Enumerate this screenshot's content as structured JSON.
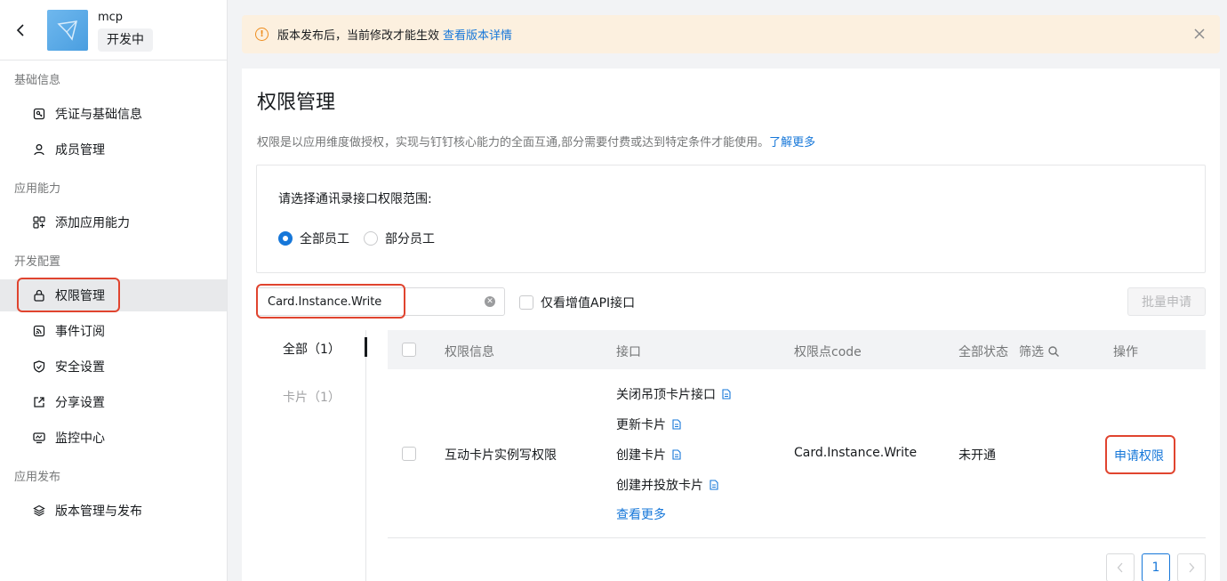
{
  "app": {
    "name": "mcp",
    "status": "开发中"
  },
  "sidebar": {
    "groups": [
      {
        "title": "基础信息",
        "items": [
          {
            "label": "凭证与基础信息",
            "icon": "credential-icon"
          },
          {
            "label": "成员管理",
            "icon": "user-icon"
          }
        ]
      },
      {
        "title": "应用能力",
        "items": [
          {
            "label": "添加应用能力",
            "icon": "apps-add-icon"
          }
        ]
      },
      {
        "title": "开发配置",
        "items": [
          {
            "label": "权限管理",
            "icon": "lock-icon",
            "active": true
          },
          {
            "label": "事件订阅",
            "icon": "rss-icon"
          },
          {
            "label": "安全设置",
            "icon": "shield-icon"
          },
          {
            "label": "分享设置",
            "icon": "share-icon"
          },
          {
            "label": "监控中心",
            "icon": "monitor-icon"
          }
        ]
      },
      {
        "title": "应用发布",
        "items": [
          {
            "label": "版本管理与发布",
            "icon": "layers-icon"
          }
        ]
      }
    ]
  },
  "notice": {
    "text": "版本发布后，当前修改才能生效",
    "link": "查看版本详情"
  },
  "main": {
    "title": "权限管理",
    "desc": "权限是以应用维度做授权，实现与钉钉核心能力的全面互通,部分需要付费或达到特定条件才能使用。",
    "desc_link": "了解更多",
    "scope_label": "请选择通讯录接口权限范围:",
    "radio_all": "全部员工",
    "radio_part": "部分员工",
    "search_value": "Card.Instance.Write",
    "only_value_api": "仅看增值API接口",
    "batch_apply": "批量申请",
    "tabs": [
      {
        "label": "全部（1）"
      },
      {
        "label": "卡片（1）"
      }
    ],
    "columns": {
      "info": "权限信息",
      "api": "接口",
      "code": "权限点code",
      "status": "全部状态",
      "filter": "筛选",
      "action": "操作"
    },
    "row": {
      "name": "互动卡片实例写权限",
      "apis": [
        "关闭吊顶卡片接口",
        "更新卡片",
        "创建卡片",
        "创建并投放卡片"
      ],
      "more": "查看更多",
      "code": "Card.Instance.Write",
      "status": "未开通",
      "action": "申请权限"
    },
    "pagination": {
      "current": "1"
    }
  },
  "colors": {
    "accent": "#1677d9",
    "highlight": "#e0442f",
    "notice_bg": "#fcf0df",
    "warn": "#ee8d1f"
  }
}
